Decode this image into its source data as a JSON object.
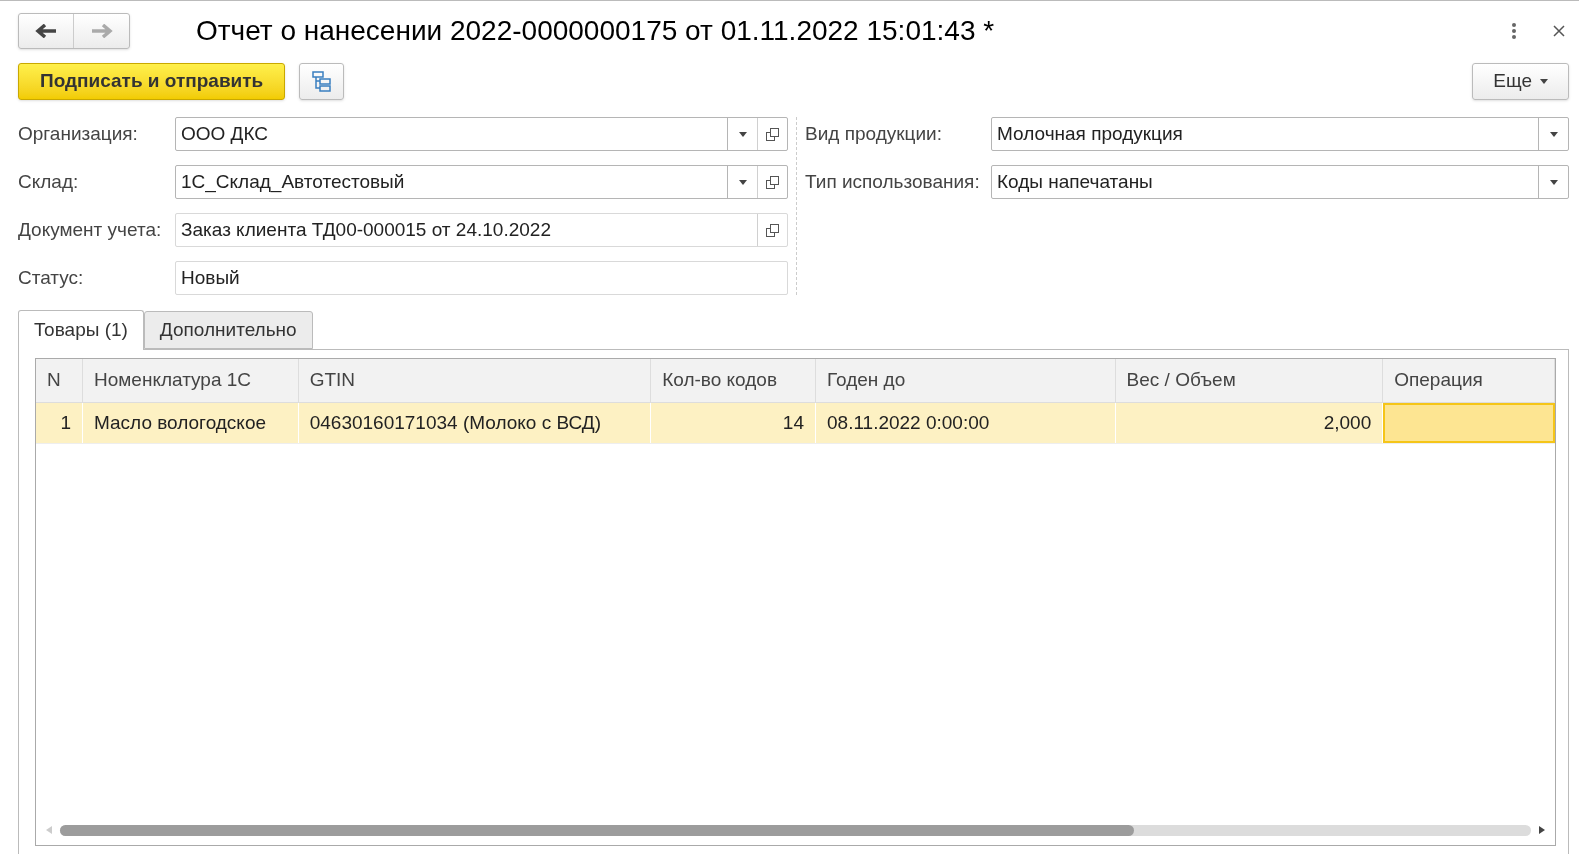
{
  "window": {
    "title": "Отчет о нанесении 2022-0000000175 от 01.11.2022 15:01:43 *"
  },
  "toolbar": {
    "primary_button": "Подписать и отправить",
    "more_button": "Еще"
  },
  "left_fields": [
    {
      "label": "Организация:",
      "value": "ООО ДКС",
      "kind": "select_open"
    },
    {
      "label": "Склад:",
      "value": "1С_Склад_Автотестовый",
      "kind": "select_open"
    },
    {
      "label": "Документ учета:",
      "value": "Заказ клиента ТД00-000015 от 24.10.2022",
      "kind": "open"
    },
    {
      "label": "Статус:",
      "value": "Новый",
      "kind": "plain"
    }
  ],
  "right_fields": [
    {
      "label": "Вид продукции:",
      "value": "Молочная продукция",
      "kind": "select"
    },
    {
      "label": "Тип использования:",
      "value": "Коды напечатаны",
      "kind": "select"
    }
  ],
  "tabs": [
    {
      "label": "Товары (1)",
      "selected": true
    },
    {
      "label": "Дополнительно",
      "selected": false
    }
  ],
  "table": {
    "columns": [
      "N",
      "Номенклатура 1С",
      "GTIN",
      "Кол-во кодов",
      "Годен до",
      "Вес / Объем",
      "Операция"
    ],
    "rows": [
      {
        "selected": true,
        "cells": [
          {
            "text": "1",
            "kind": "number",
            "focused": false
          },
          {
            "text": "Масло вологодское",
            "kind": "text",
            "focused": false
          },
          {
            "text": "04630160171034 (Молоко с ВСД)",
            "kind": "text",
            "focused": false
          },
          {
            "text": "14",
            "kind": "number",
            "focused": false
          },
          {
            "text": "08.11.2022 0:00:00",
            "kind": "text",
            "focused": false
          },
          {
            "text": "2,000",
            "kind": "number",
            "focused": false
          },
          {
            "kind": "text",
            "focused": true
          }
        ]
      }
    ]
  }
}
